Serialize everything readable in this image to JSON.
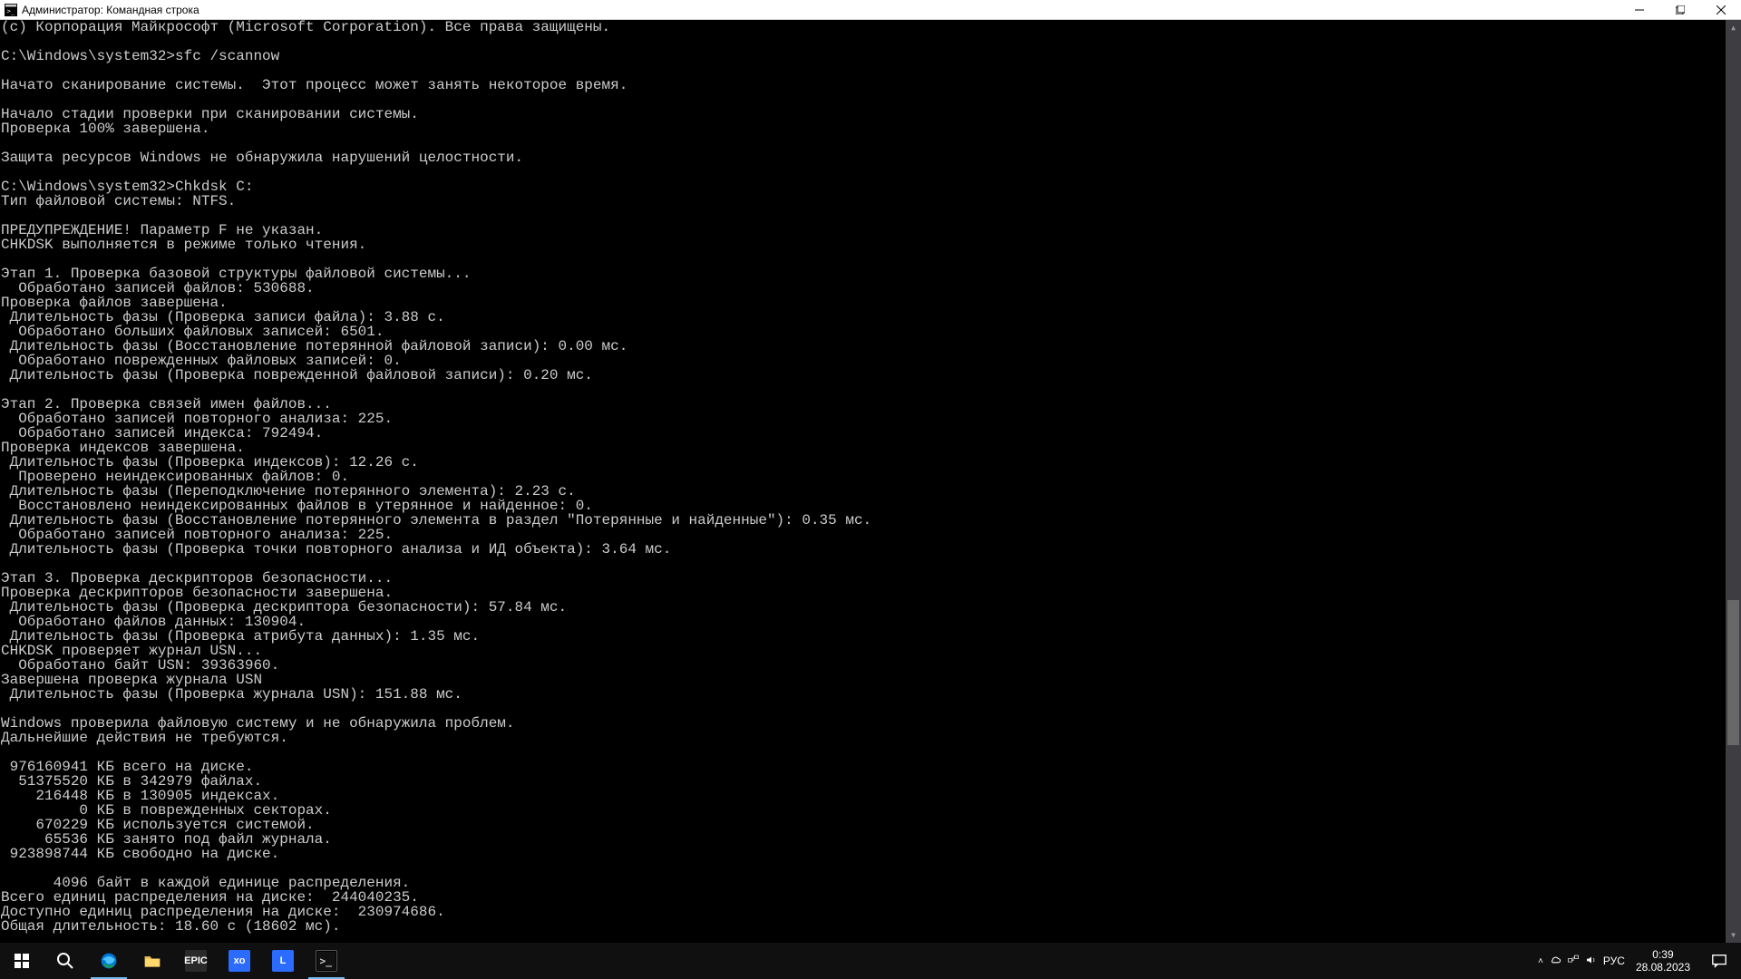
{
  "window": {
    "title": "Администратор: Командная строка"
  },
  "console_lines": [
    "(c) Корпорация Майкрософт (Microsoft Corporation). Все права защищены.",
    "",
    "C:\\Windows\\system32>sfc /scannow",
    "",
    "Начато сканирование системы.  Этот процесс может занять некоторое время.",
    "",
    "Начало стадии проверки при сканировании системы.",
    "Проверка 100% завершена.",
    "",
    "Защита ресурсов Windows не обнаружила нарушений целостности.",
    "",
    "C:\\Windows\\system32>Chkdsk C:",
    "Тип файловой системы: NTFS.",
    "",
    "ПРЕДУПРЕЖДЕНИЕ! Параметр F не указан.",
    "CHKDSK выполняется в режиме только чтения.",
    "",
    "Этап 1. Проверка базовой структуры файловой системы...",
    "  Обработано записей файлов: 530688.",
    "Проверка файлов завершена.",
    " Длительность фазы (Проверка записи файла): 3.88 с.",
    "  Обработано больших файловых записей: 6501.",
    " Длительность фазы (Восстановление потерянной файловой записи): 0.00 мс.",
    "  Обработано поврежденных файловых записей: 0.",
    " Длительность фазы (Проверка поврежденной файловой записи): 0.20 мс.",
    "",
    "Этап 2. Проверка связей имен файлов...",
    "  Обработано записей повторного анализа: 225.",
    "  Обработано записей индекса: 792494.",
    "Проверка индексов завершена.",
    " Длительность фазы (Проверка индексов): 12.26 с.",
    "  Проверено неиндексированных файлов: 0.",
    " Длительность фазы (Переподключение потерянного элемента): 2.23 с.",
    "  Восстановлено неиндексированных файлов в утерянное и найденное: 0.",
    " Длительность фазы (Восстановление потерянного элемента в раздел \"Потерянные и найденные\"): 0.35 мс.",
    "  Обработано записей повторного анализа: 225.",
    " Длительность фазы (Проверка точки повторного анализа и ИД объекта): 3.64 мс.",
    "",
    "Этап 3. Проверка дескрипторов безопасности...",
    "Проверка дескрипторов безопасности завершена.",
    " Длительность фазы (Проверка дескриптора безопасности): 57.84 мс.",
    "  Обработано файлов данных: 130904.",
    " Длительность фазы (Проверка атрибута данных): 1.35 мс.",
    "CHKDSK проверяет журнал USN...",
    "  Обработано байт USN: 39363960.",
    "Завершена проверка журнала USN",
    " Длительность фазы (Проверка журнала USN): 151.88 мс.",
    "",
    "Windows проверила файловую систему и не обнаружила проблем.",
    "Дальнейшие действия не требуются.",
    "",
    " 976160941 КБ всего на диске.",
    "  51375520 КБ в 342979 файлах.",
    "    216448 КБ в 130905 индексах.",
    "         0 КБ в поврежденных секторах.",
    "    670229 КБ используется системой.",
    "     65536 КБ занято под файл журнала.",
    " 923898744 КБ свободно на диске.",
    "",
    "      4096 байт в каждой единице распределения.",
    "Всего единиц распределения на диске:  244040235.",
    "Доступно единиц распределения на диске:  230974686.",
    "Общая длительность: 18.60 с (18602 мс)."
  ],
  "tray": {
    "lang": "РУС",
    "time": "0:39",
    "date": "28.08.2023"
  }
}
